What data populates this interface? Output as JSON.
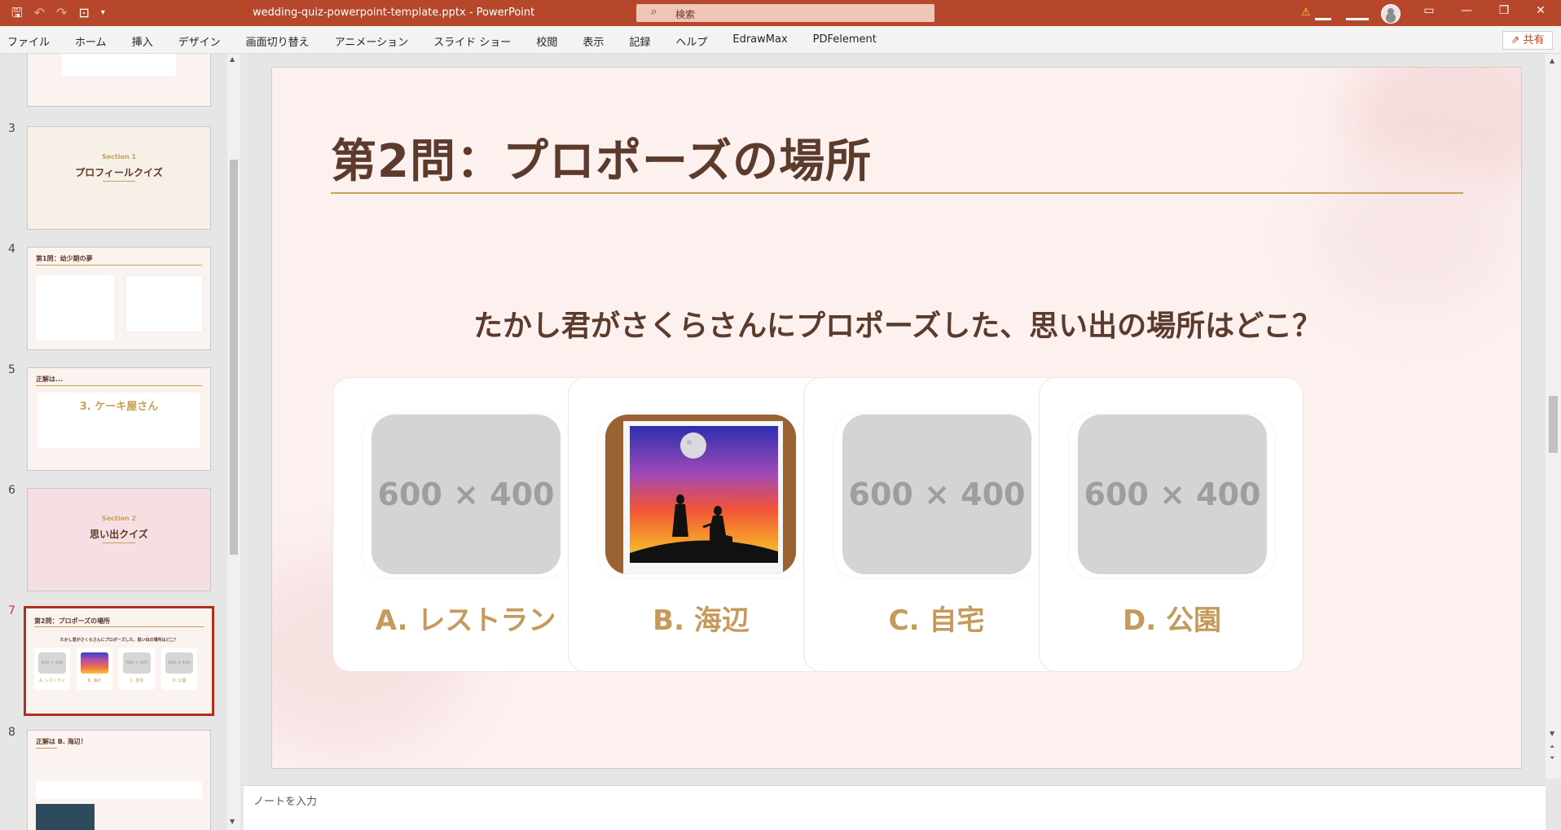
{
  "window": {
    "doc_title": "wedding-quiz-powerpoint-template.pptx  -  PowerPoint",
    "search_placeholder": "検索"
  },
  "ribbon": {
    "tabs": [
      "ファイル",
      "ホーム",
      "挿入",
      "デザイン",
      "画面切り替え",
      "アニメーション",
      "スライド ショー",
      "校閲",
      "表示",
      "記録",
      "ヘルプ",
      "EdrawMax",
      "PDFelement"
    ],
    "share_label": "共有"
  },
  "thumbnails": {
    "numbers": [
      "3",
      "4",
      "5",
      "6",
      "7",
      "8"
    ],
    "s3": {
      "section": "Section 1",
      "title": "プロフィールクイズ"
    },
    "s4": {
      "title": "第1問：幼少期の夢"
    },
    "s5": {
      "title": "正解は...",
      "answer": "3. ケーキ屋さん"
    },
    "s6": {
      "section": "Section 2",
      "title": "思い出クイズ"
    },
    "s7": {
      "title": "第2問：プロポーズの場所",
      "question": "たかし君がさくらさんにプロポーズした、思い出の場所はどこ？",
      "ph": "600 × 400",
      "labels": [
        "A. レストラン",
        "B. 海辺",
        "C. 自宅",
        "D. 公園"
      ]
    },
    "s8": {
      "title": "正解は B. 海辺！"
    }
  },
  "slide": {
    "title": "第2問：プロポーズの場所",
    "question": "たかし君がさくらさんにプロポーズした、思い出の場所はどこ？",
    "placeholder": "600 × 400",
    "answers": [
      {
        "label": "A. レストラン",
        "image": "placeholder"
      },
      {
        "label": "B. 海辺",
        "image": "sunset-proposal-painting"
      },
      {
        "label": "C. 自宅",
        "image": "placeholder"
      },
      {
        "label": "D. 公園",
        "image": "placeholder"
      }
    ]
  },
  "notes": {
    "placeholder": "ノートを入力"
  },
  "colors": {
    "accent": "#b7472a",
    "title_brown": "#5d3b2c",
    "gold": "#c59a5b"
  }
}
